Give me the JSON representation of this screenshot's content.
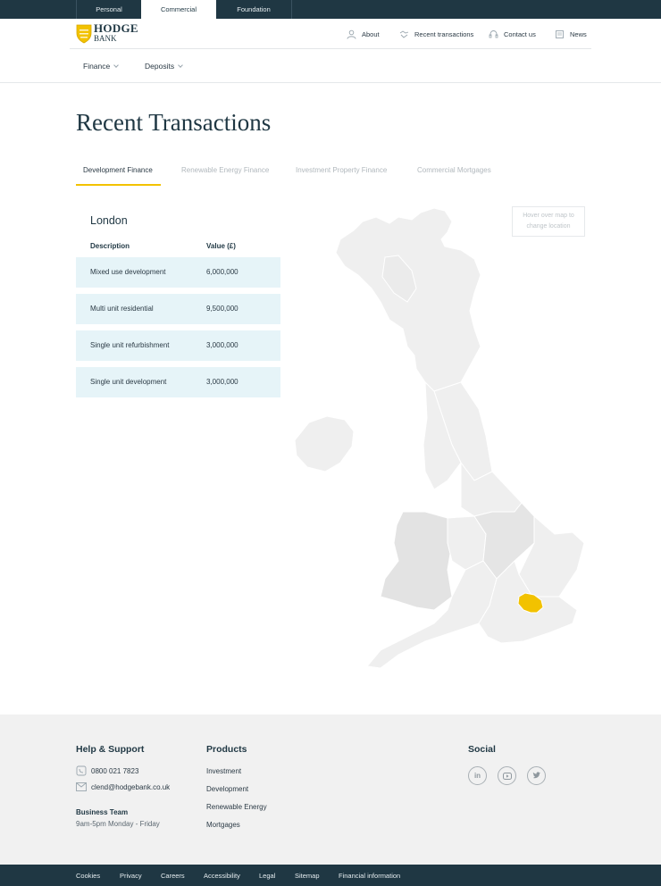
{
  "topbar": {
    "tabs": [
      {
        "label": "Personal",
        "active": false
      },
      {
        "label": "Commercial",
        "active": true
      },
      {
        "label": "Foundation",
        "active": false
      }
    ]
  },
  "brand": {
    "name_line1": "HODGE",
    "name_line2": "BANK",
    "accent": "#f2c200",
    "dark": "#1f3743"
  },
  "header_nav": [
    {
      "label": "About",
      "icon": "person-icon"
    },
    {
      "label": "Recent transactions",
      "icon": "handshake-icon"
    },
    {
      "label": "Contact us",
      "icon": "headset-icon"
    },
    {
      "label": "News",
      "icon": "newspaper-icon"
    }
  ],
  "subnav": [
    {
      "label": "Finance"
    },
    {
      "label": "Deposits"
    }
  ],
  "page": {
    "title": "Recent Transactions"
  },
  "finance_tabs": [
    {
      "label": "Development Finance",
      "active": true
    },
    {
      "label": "Renewable Energy Finance",
      "active": false
    },
    {
      "label": "Investment Property Finance",
      "active": false
    },
    {
      "label": "Commercial Mortgages",
      "active": false
    }
  ],
  "transactions": {
    "location": "London",
    "headers": {
      "description": "Description",
      "value": "Value (£)"
    },
    "rows": [
      {
        "description": "Mixed use development",
        "value": "6,000,000"
      },
      {
        "description": "Multi unit residential",
        "value": "9,500,000"
      },
      {
        "description": "Single unit refurbishment",
        "value": "3,000,000"
      },
      {
        "description": "Single unit development",
        "value": "3,000,000"
      }
    ]
  },
  "map": {
    "hint": "Hover over map to change location",
    "highlight_region": "London",
    "highlight_color": "#f2c200"
  },
  "footer": {
    "help": {
      "title": "Help & Support",
      "phone": "0800 021 7823",
      "email": "clend@hodgebank.co.uk",
      "team_title": "Business Team",
      "hours": "9am-5pm Monday - Friday"
    },
    "products": {
      "title": "Products",
      "links": [
        "Investment",
        "Development",
        "Renewable Energy",
        "Mortgages"
      ]
    },
    "social": {
      "title": "Social",
      "icons": [
        "linkedin-icon",
        "youtube-icon",
        "twitter-icon"
      ]
    }
  },
  "bottom_links": [
    "Cookies",
    "Privacy",
    "Careers",
    "Accessibility",
    "Legal",
    "Sitemap",
    "Financial information"
  ]
}
